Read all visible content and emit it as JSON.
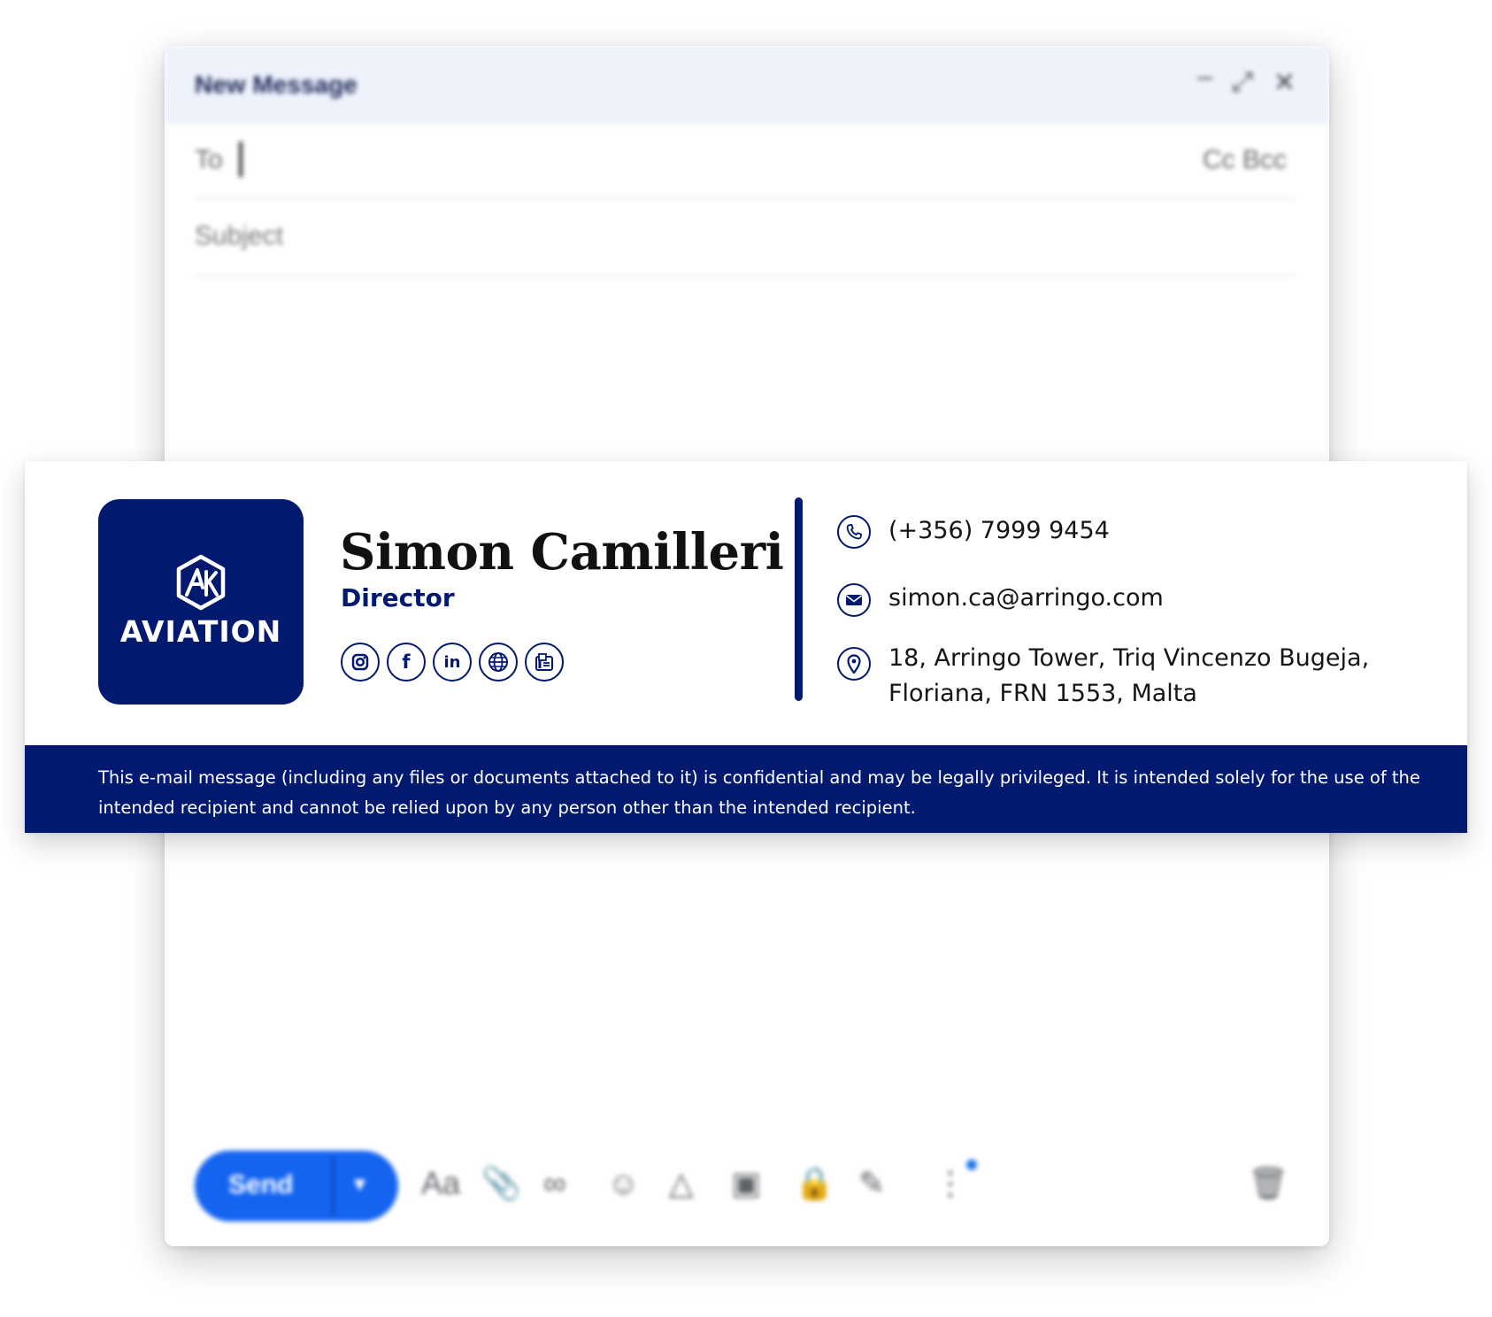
{
  "compose": {
    "title": "New Message",
    "window_buttons": {
      "minimize": "–",
      "expand": "⤢",
      "close": "✕"
    },
    "to_label": "To",
    "cc_bcc": "Cc Bcc",
    "subject_placeholder": "Subject",
    "send_label": "Send",
    "toolbar_icons": [
      "format-text-icon",
      "attach-icon",
      "link-icon",
      "emoji-icon",
      "drive-icon",
      "photo-icon",
      "lock-icon",
      "signature-icon",
      "more-options-icon",
      "trash-icon"
    ],
    "toolbar_glyphs": {
      "format": "Aa",
      "attach": "📎",
      "link": "∞",
      "emoji": "☺",
      "drive": "△",
      "photo": "▣",
      "lock": "🔒",
      "pen": "✎",
      "more": "⋮",
      "trash": "🗑"
    }
  },
  "signature": {
    "logo_text": "AVIATION",
    "logo_mark": "AK",
    "name": "Simon Camilleri",
    "job_title": "Director",
    "social_icons": [
      "instagram-icon",
      "facebook-icon",
      "linkedin-icon",
      "website-icon",
      "fax-icon"
    ],
    "social_glyphs": {
      "facebook": "f",
      "linkedin": "in"
    },
    "phone": "(+356) 7999 9454",
    "email": "simon.ca@arringo.com",
    "address_line1": "18, Arringo Tower, Triq Vincenzo Bugeja,",
    "address_line2": "Floriana, FRN 1553, Malta",
    "disclaimer": "This e-mail message (including any files or documents attached to it) is confidential and may be legally privileged. It is intended solely for the use of the intended recipient and cannot be relied upon by any person other than the intended recipient.",
    "brand_color": "#021970"
  }
}
